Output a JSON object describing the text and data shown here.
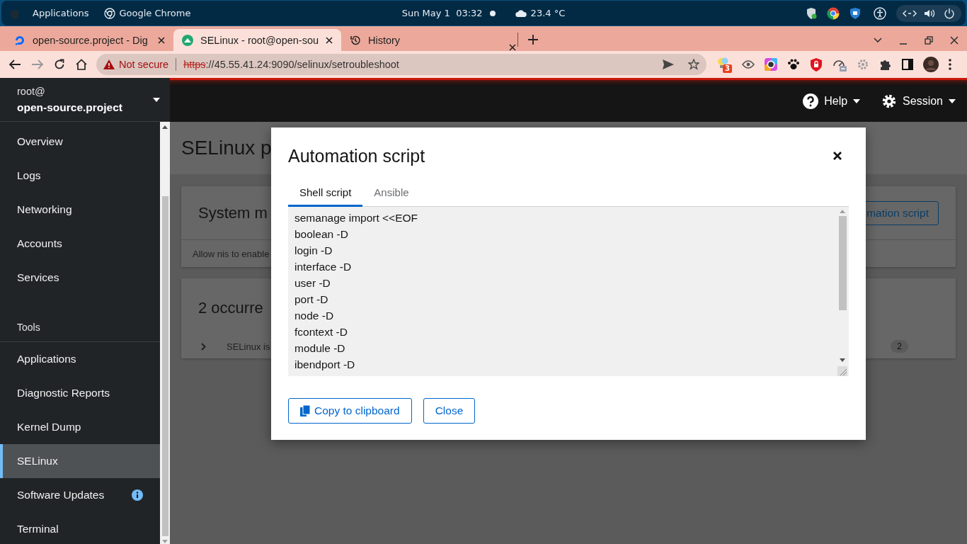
{
  "desktop_bar": {
    "apps_label": "Applications",
    "app_name": "Google Chrome",
    "clock": "Sun May 1  03:32",
    "weather": "23.4 °C"
  },
  "browser": {
    "tabs": [
      {
        "title": "open-source.project - Dig",
        "selected": false
      },
      {
        "title": "SELinux - root@open-sou",
        "selected": true
      },
      {
        "title": "History",
        "selected": false
      }
    ],
    "security_label": "Not secure",
    "url_scheme": "https",
    "url_rest": "://45.55.41.24:9090/selinux/setroubleshoot",
    "extension_badge": "3"
  },
  "host": {
    "user": "root@",
    "name": "open-source.project"
  },
  "sidebar": {
    "items": [
      {
        "kind": "link",
        "label": "Overview",
        "selected": false,
        "info": false
      },
      {
        "kind": "link",
        "label": "Logs",
        "selected": false,
        "info": false
      },
      {
        "kind": "link",
        "label": "Networking",
        "selected": false,
        "info": false
      },
      {
        "kind": "link",
        "label": "Accounts",
        "selected": false,
        "info": false
      },
      {
        "kind": "link",
        "label": "Services",
        "selected": false,
        "info": false
      },
      {
        "kind": "heading",
        "label": "Tools"
      },
      {
        "kind": "link",
        "label": "Applications",
        "selected": false,
        "info": false
      },
      {
        "kind": "link",
        "label": "Diagnostic Reports",
        "selected": false,
        "info": false
      },
      {
        "kind": "link",
        "label": "Kernel Dump",
        "selected": false,
        "info": false
      },
      {
        "kind": "link",
        "label": "SELinux",
        "selected": true,
        "info": false
      },
      {
        "kind": "link",
        "label": "Software Updates",
        "selected": false,
        "info": true
      },
      {
        "kind": "link",
        "label": "Terminal",
        "selected": false,
        "info": false
      }
    ]
  },
  "header": {
    "help": "Help",
    "session": "Session"
  },
  "page": {
    "title": "SELinux p",
    "modifications_title": "System m",
    "modifications_button": "mation script",
    "modification_text": "Allow nis to enable",
    "occurrences_title": "2 occurre",
    "alert_text": "SELinux is",
    "alert_count": "2"
  },
  "dialog": {
    "title": "Automation script",
    "tabs": [
      {
        "label": "Shell script",
        "selected": true
      },
      {
        "label": "Ansible",
        "selected": false
      }
    ],
    "script_lines": [
      "semanage import <<EOF",
      "boolean -D",
      "login -D",
      "interface -D",
      "user -D",
      "port -D",
      "node -D",
      "fcontext -D",
      "module -D",
      "ibendport -D"
    ],
    "buttons": [
      {
        "label": "Copy to clipboard",
        "kind": "copy"
      },
      {
        "label": "Close",
        "kind": "plain"
      }
    ]
  }
}
